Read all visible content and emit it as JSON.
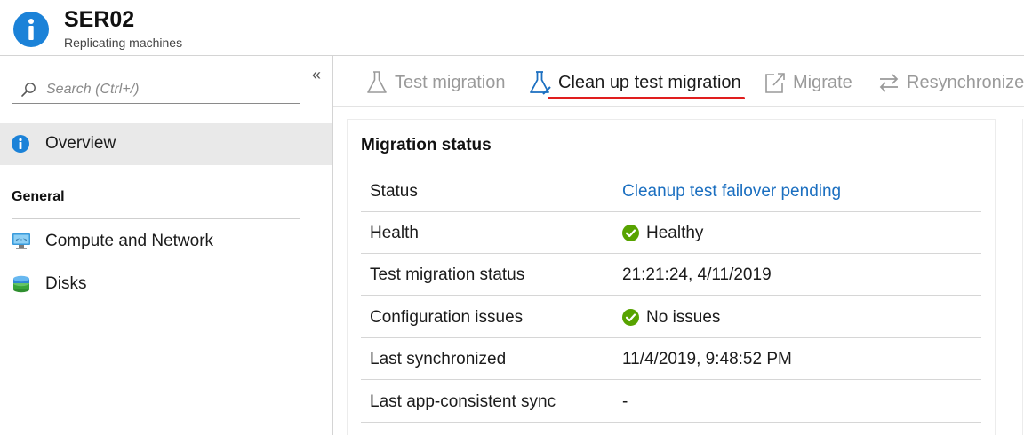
{
  "header": {
    "title": "SER02",
    "subtitle": "Replicating machines",
    "icon": "info-icon",
    "icon_color": "#1b82d8"
  },
  "sidebar": {
    "search_placeholder": "Search (Ctrl+/)",
    "collapse_glyph": "«",
    "overview_label": "Overview",
    "section_general": "General",
    "items": [
      {
        "label": "Compute and Network",
        "icon": "compute-network-icon"
      },
      {
        "label": "Disks",
        "icon": "disks-icon"
      }
    ]
  },
  "toolbar": {
    "test_migration": "Test migration",
    "cleanup_test_migration": "Clean up test migration",
    "migrate": "Migrate",
    "resynchronize": "Resynchronize"
  },
  "panel": {
    "title": "Migration status",
    "rows": [
      {
        "key": "Status",
        "value": "Cleanup test failover pending"
      },
      {
        "key": "Health",
        "value": "Healthy"
      },
      {
        "key": "Test migration status",
        "value": "21:21:24, 4/11/2019"
      },
      {
        "key": "Configuration issues",
        "value": "No issues"
      },
      {
        "key": "Last synchronized",
        "value": "11/4/2019, 9:48:52 PM"
      },
      {
        "key": "Last app-consistent sync",
        "value": "-"
      }
    ]
  },
  "colors": {
    "accent_blue": "#1b6fc0",
    "success_green": "#57a300",
    "highlight_red": "#e01e1e"
  }
}
